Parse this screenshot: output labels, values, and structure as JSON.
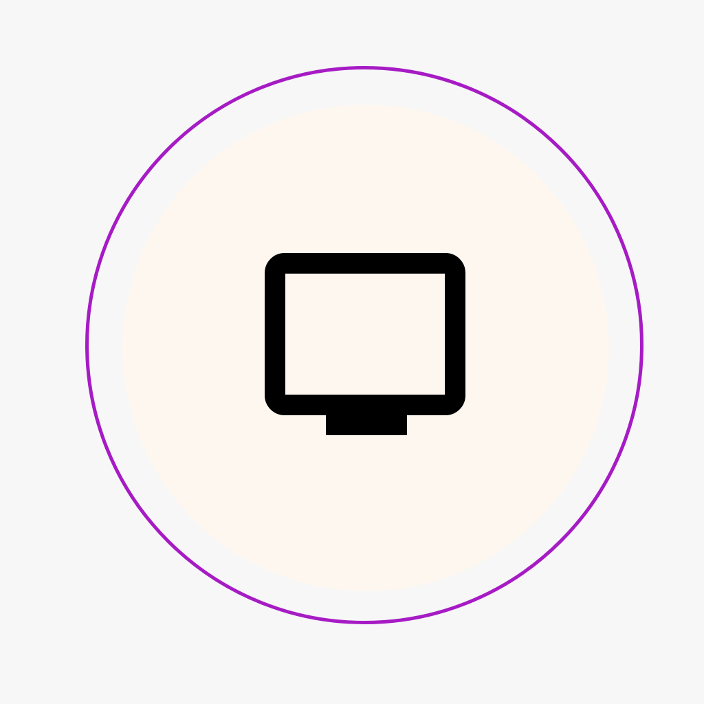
{
  "screen": {
    "background": "#f7f7f8"
  },
  "device_button": {
    "icon": "monitor-icon",
    "fill_color": "#fdf7f0",
    "focus_ring_color": "#a61bc4",
    "icon_color": "#000000",
    "focused": true
  }
}
